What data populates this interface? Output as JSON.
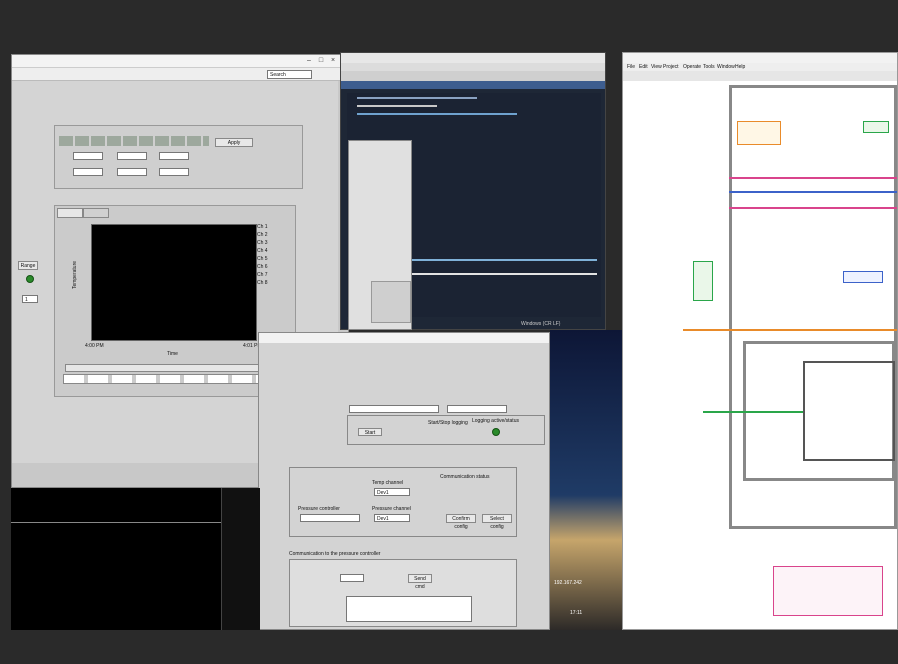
{
  "front_panel": {
    "search_placeholder": "Search",
    "legend_channels": [
      "Ch 1",
      "Ch 2",
      "Ch 3",
      "Ch 4",
      "Ch 5",
      "Ch 6",
      "Ch 7",
      "Ch 8"
    ],
    "chart_time_label": "Time",
    "chart_x_start": "4:00 PM",
    "chart_x_end": "4:01 PM",
    "chart_y_label": "Temperature",
    "range_button": "Range",
    "range_value": "1"
  },
  "ide": {
    "menus": [
      "File",
      "Edit",
      "View",
      "Project",
      "Operate",
      "Tools",
      "Window",
      "Help"
    ],
    "status": "Windows (CR LF)"
  },
  "pressure_dialog": {
    "group_title": "Communication to the pressure controller",
    "send_button": "Send cmd",
    "comm_status": "Communication status",
    "pressure_controller_label": "Pressure controller",
    "pressure_channel_label": "Pressure channel",
    "temp_channel_label": "Temp channel",
    "channel_value": "Dev1",
    "config_buttons": [
      "Confirm config",
      "Select config"
    ],
    "start_logging": "Start/Stop logging",
    "logging_status": "Logging active/status",
    "start_label": "Start"
  },
  "desktop": {
    "clock": "17:11",
    "ip": "192.167.242"
  },
  "colors": {
    "desktop": "#2a2a2a",
    "lv_gray": "#d4d4d4",
    "code_bg": "#1e2736",
    "block_wire_orange": "#e98b2a",
    "block_wire_pink": "#d9448c",
    "block_wire_blue": "#3c62c9"
  }
}
